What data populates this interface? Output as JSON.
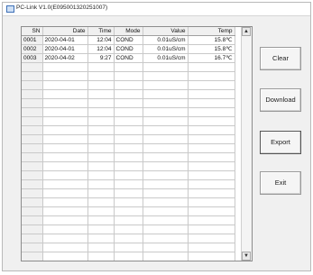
{
  "window": {
    "title": "PC-Link V1.0(E095001320251007)"
  },
  "table": {
    "columns": [
      "SN",
      "Date",
      "Time",
      "Mode",
      "Value",
      "Temp"
    ],
    "rows": [
      [
        "0001",
        "2020-04-01",
        "12:04",
        "COND",
        "0.01uS/cm",
        "15.8℃"
      ],
      [
        "0002",
        "2020-04-01",
        "12:04",
        "COND",
        "0.01uS/cm",
        "15.8℃"
      ],
      [
        "0003",
        "2020-04-02",
        "9:27",
        "COND",
        "0.01uS/cm",
        "16.7℃"
      ]
    ],
    "empty_row_count": 22
  },
  "scrollbar": {
    "up_icon": "up-arrow",
    "down_icon": "down-arrow"
  },
  "buttons": {
    "clear": "Clear",
    "download": "Download",
    "export": "Export",
    "exit": "Exit"
  }
}
